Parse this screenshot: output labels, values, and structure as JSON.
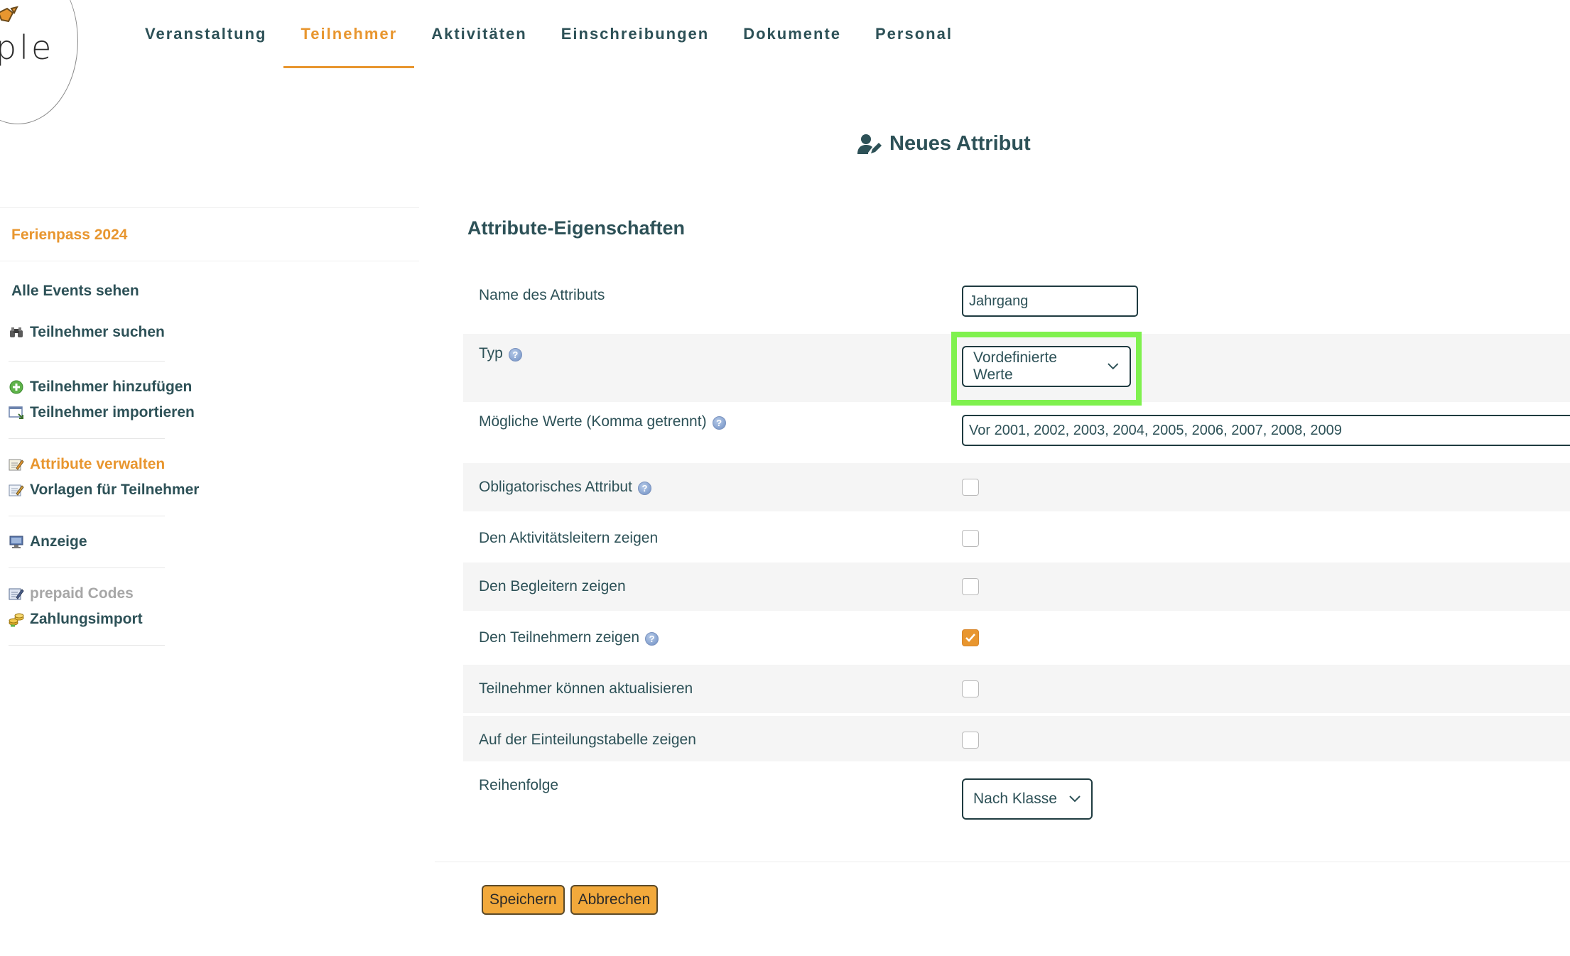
{
  "logo": {
    "text": "ple"
  },
  "nav": {
    "tabs": [
      "Veranstaltung",
      "Teilnehmer",
      "Aktivitäten",
      "Einschreibungen",
      "Dokumente",
      "Personal"
    ],
    "active": "Teilnehmer"
  },
  "page": {
    "title": "Neues Attribut",
    "icon": "user-edit-icon"
  },
  "sidebar": {
    "event": "Ferienpass 2024",
    "all_events": "Alle Events sehen",
    "items": [
      {
        "label": "Teilnehmer suchen",
        "icon": "binoculars-icon"
      },
      {
        "label": "Teilnehmer hinzufügen",
        "icon": "add-circle-icon"
      },
      {
        "label": "Teilnehmer importieren",
        "icon": "import-icon"
      },
      {
        "label": "Attribute verwalten",
        "icon": "edit-note-icon",
        "state": "active"
      },
      {
        "label": "Vorlagen für Teilnehmer",
        "icon": "template-icon"
      },
      {
        "label": "Anzeige",
        "icon": "monitor-icon"
      },
      {
        "label": "prepaid Codes",
        "icon": "note-pencil-icon",
        "state": "disabled"
      },
      {
        "label": "Zahlungsimport",
        "icon": "coins-icon"
      }
    ]
  },
  "form": {
    "section_title": "Attribute-Eigenschaften",
    "name_label": "Name des Attributs",
    "name_value": "Jahrgang",
    "type_label": "Typ",
    "type_value": "Vordefinierte Werte",
    "values_label": "Mögliche Werte (Komma getrennt)",
    "values_value": "Vor 2001, 2002, 2003, 2004, 2005, 2006, 2007, 2008, 2009",
    "checkboxes": [
      {
        "label": "Obligatorisches Attribut",
        "help": true,
        "checked": false
      },
      {
        "label": "Den Aktivitätsleitern zeigen",
        "help": false,
        "checked": false
      },
      {
        "label": "Den Begleitern zeigen",
        "help": false,
        "checked": false
      },
      {
        "label": "Den Teilnehmern zeigen",
        "help": true,
        "checked": true
      },
      {
        "label": "Teilnehmer können aktualisieren",
        "help": false,
        "checked": false
      },
      {
        "label": "Auf der Einteilungstabelle zeigen",
        "help": false,
        "checked": false
      }
    ],
    "order_label": "Reihenfolge",
    "order_value": "Nach Klasse",
    "save_label": "Speichern",
    "cancel_label": "Abbrechen"
  },
  "colors": {
    "accent": "#e8962f",
    "text": "#2d5157",
    "highlight": "#7ff14e",
    "button": "#f2a93b"
  }
}
